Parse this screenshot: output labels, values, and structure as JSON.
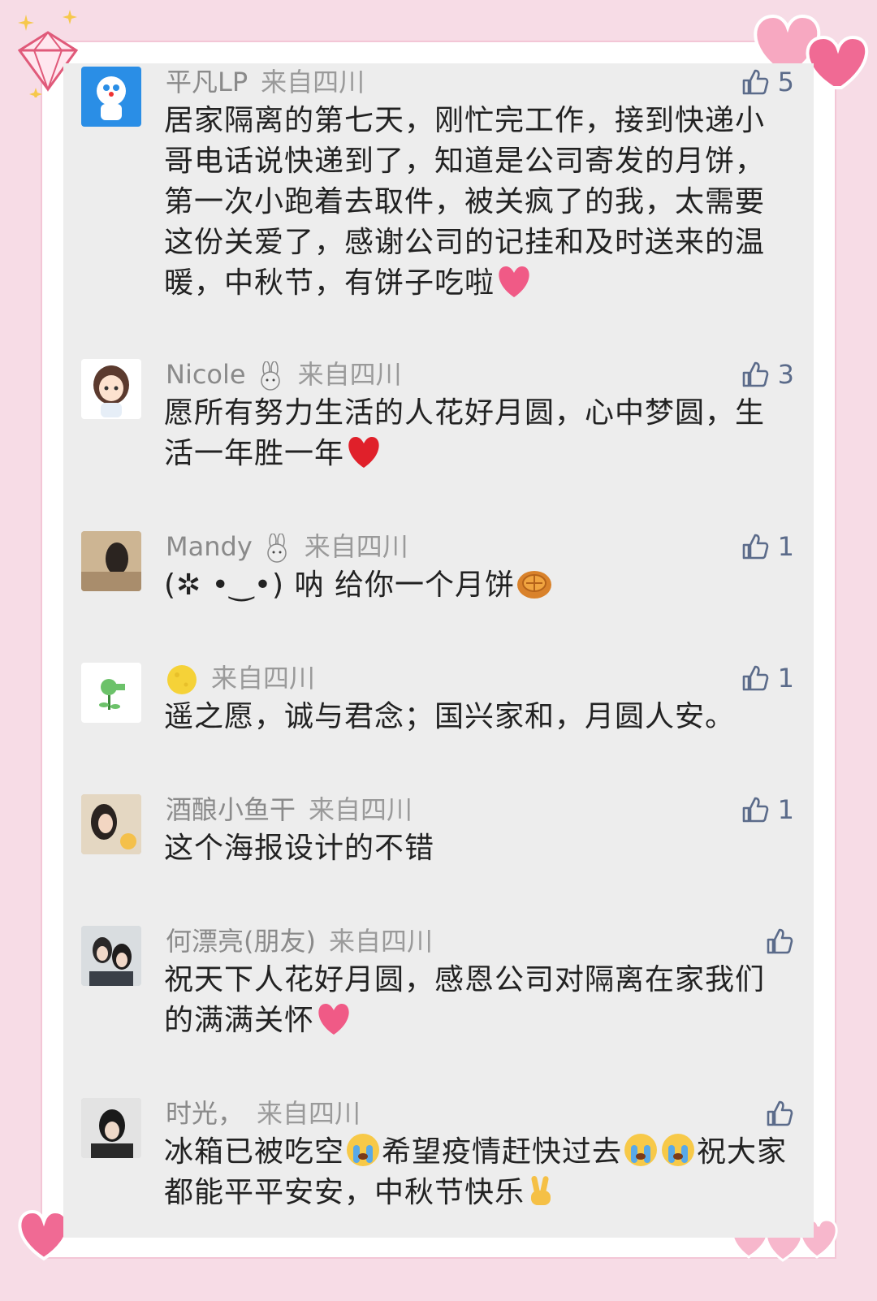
{
  "comments": [
    {
      "name": "平凡LP",
      "source": "来自四川",
      "likes": "5",
      "text": "居家隔离的第七天，刚忙完工作，接到快递小哥电话说快递到了，知道是公司寄发的月饼，第一次小跑着去取件，被关疯了的我，太需要这份关爱了，感谢公司的记挂和及时送来的温暖，中秋节，有饼子吃啦",
      "name_emoji": "",
      "text_emoji": "pink-heart-icon"
    },
    {
      "name": "Nicole",
      "source": "来自四川",
      "likes": "3",
      "text": "愿所有努力生活的人花好月圆，心中梦圆，生活一年胜一年",
      "name_emoji": "rabbit-icon",
      "text_emoji": "red-heart-icon"
    },
    {
      "name": "Mandy",
      "source": "来自四川",
      "likes": "1",
      "text": "(✲ •‿•) 呐 给你一个月饼",
      "name_emoji": "rabbit-icon",
      "text_emoji": "mooncake-icon"
    },
    {
      "name": "",
      "source": "来自四川",
      "likes": "1",
      "text": "遥之愿，诚与君念；国兴家和，月圆人安。",
      "name_emoji": "moon-icon",
      "text_emoji": ""
    },
    {
      "name": "酒酿小鱼干",
      "source": "来自四川",
      "likes": "1",
      "text": "这个海报设计的不错",
      "name_emoji": "",
      "text_emoji": ""
    },
    {
      "name": "何漂亮(朋友)",
      "source": "来自四川",
      "likes": "",
      "text": "祝天下人花好月圆，感恩公司对隔离在家我们的满满关怀",
      "name_emoji": "",
      "text_emoji": "pink-heart-icon"
    },
    {
      "name": "时光，",
      "source": "来自四川",
      "likes": "",
      "text_parts": [
        "冰箱已被吃空",
        "希望疫情赶快过去",
        "祝大家都能平平安安，中秋节快乐"
      ],
      "name_emoji": "",
      "text_emoji": "crying-face-icon"
    }
  ],
  "colors": {
    "background": "#f7dce6",
    "panel": "#ededed",
    "like": "#5b6b8a",
    "meta": "#8a8a8a"
  }
}
